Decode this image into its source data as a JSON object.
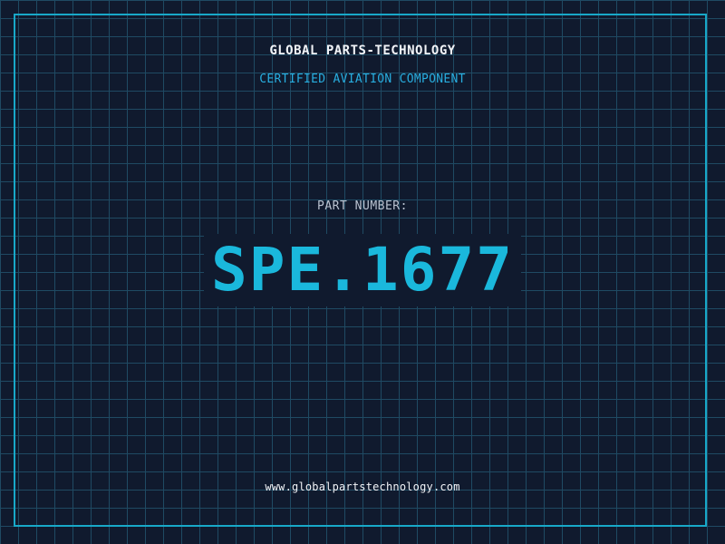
{
  "header": {
    "company": "GLOBAL PARTS-TECHNOLOGY",
    "subtitle": "CERTIFIED AVIATION COMPONENT"
  },
  "part": {
    "label": "PART NUMBER:",
    "number": "SPE.1677"
  },
  "footer": {
    "url": "www.globalpartstechnology.com"
  },
  "colors": {
    "background": "#101a2e",
    "grid": "#1f4a63",
    "frame": "#18a8c8",
    "accent": "#1ab8dc",
    "subtitle": "#28aee0",
    "text": "#f2f4f8"
  }
}
